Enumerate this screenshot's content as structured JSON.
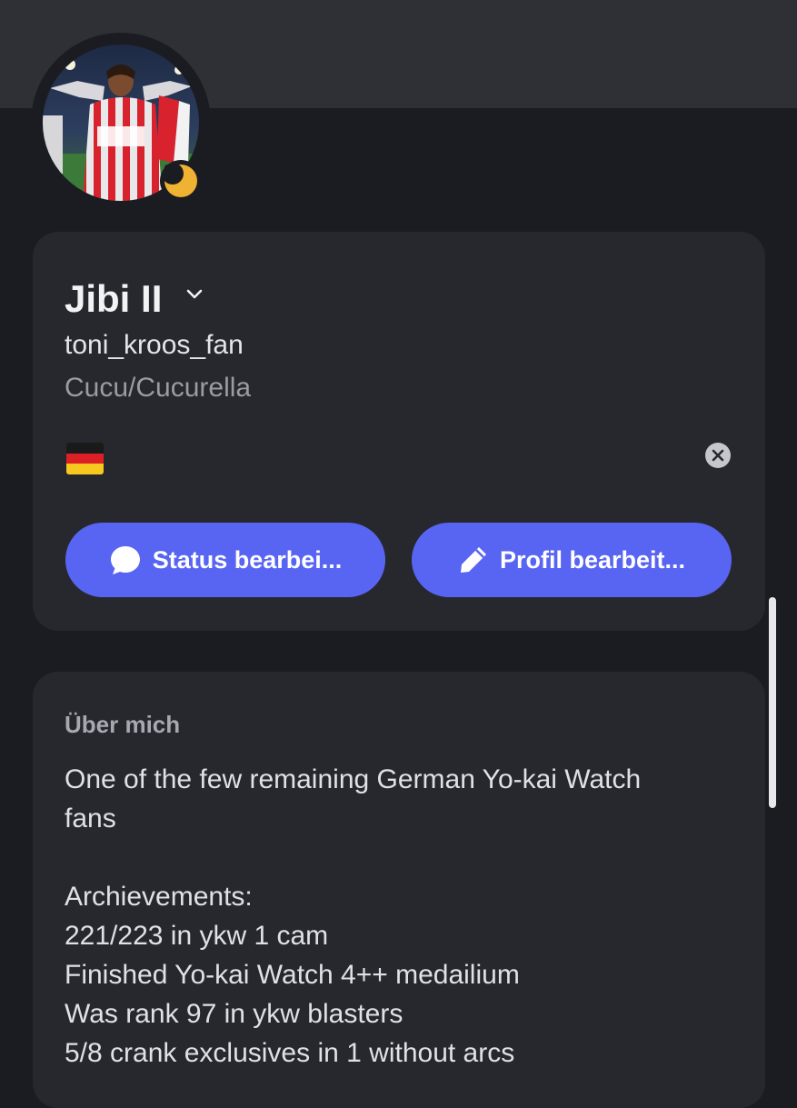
{
  "profile": {
    "display_name": "Jibi II",
    "username": "toni_kroos_fan",
    "pronouns": "Cucu/Cucurella",
    "status_emoji": "germany-flag",
    "status_indicator": "idle-moon-icon",
    "buttons": {
      "status_label": "Status bearbei...",
      "profile_label": "Profil bearbeit..."
    }
  },
  "about": {
    "title": "Über mich",
    "lines": [
      "One of the few remaining German Yo-kai Watch",
      "fans",
      "",
      "Archievements:",
      "221/223 in ykw 1 cam",
      "Finished Yo-kai Watch 4++ medailium",
      "Was rank 97 in ykw blasters",
      "5/8 crank exclusives in 1 without arcs"
    ]
  },
  "colors": {
    "background": "#1b1c21",
    "banner": "#2f3035",
    "card": "#27282e",
    "accent": "#5865f2",
    "idle": "#f0b232"
  }
}
